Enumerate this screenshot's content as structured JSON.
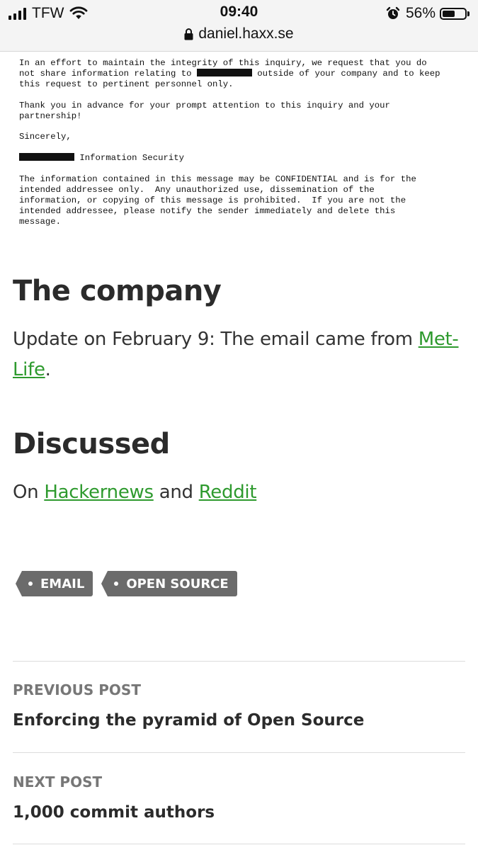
{
  "status_bar": {
    "carrier": "TFW",
    "time": "09:40",
    "battery_percent": "56%",
    "battery_level": 0.56,
    "url": "daniel.haxx.se"
  },
  "email": {
    "para1_line1": "In an effort to maintain the integrity of this inquiry, we request that you do",
    "para1_line2_before": "not share information relating to ",
    "para1_line2_after": " outside of your company and to keep",
    "para1_line3": "this request to pertinent personnel only.",
    "para2_line1": "Thank you in advance for your prompt attention to this inquiry and your",
    "para2_line2": "partnership!",
    "closing": "Sincerely,",
    "signature_suffix": " Information Security",
    "disclaimer_line1": "The information contained in this message may be CONFIDENTIAL and is for the",
    "disclaimer_line2": "intended addressee only.  Any unauthorized use, dissemination of the",
    "disclaimer_line3": "information, or copying of this message is prohibited.  If you are not the",
    "disclaimer_line4": "intended addressee, please notify the sender immediately and delete this",
    "disclaimer_line5": "message."
  },
  "company_section": {
    "title": "The company",
    "text_before": "Update on February 9: The email came from ",
    "link_text": "Met-Life",
    "text_after": "."
  },
  "discussed_section": {
    "title": "Discussed",
    "text_on": "On ",
    "link1": "Hackernews",
    "text_and": " and ",
    "link2": "Reddit"
  },
  "tags": [
    "EMAIL",
    "OPEN SOURCE"
  ],
  "post_nav": {
    "previous_label": "PREVIOUS POST",
    "previous_title": "Enforcing the pyramid of Open Source",
    "next_label": "NEXT POST",
    "next_title": "1,000 commit authors"
  },
  "colors": {
    "link": "#2e9a2e",
    "tag_bg": "#6b6b6b",
    "redaction": "#111111"
  }
}
